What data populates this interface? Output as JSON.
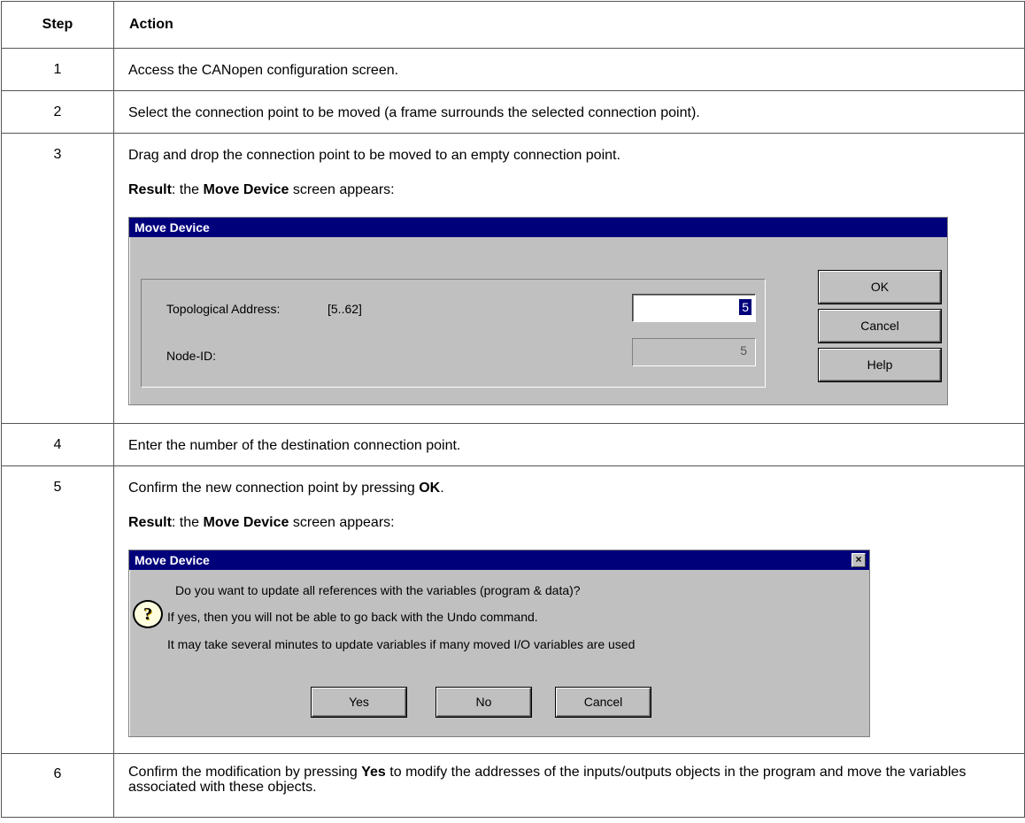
{
  "headers": {
    "step": "Step",
    "action": "Action"
  },
  "rows": [
    {
      "step": "1",
      "text": "Access the CANopen configuration screen."
    },
    {
      "step": "2",
      "text": "Select the connection point to be moved (a frame surrounds the selected connection point)."
    },
    {
      "step": "3",
      "text": "Drag and drop the connection point to be moved to an empty connection point.",
      "result_label": "Result",
      "result_pre": ": the ",
      "result_bold": "Move Device",
      "result_post": " screen appears:"
    },
    {
      "step": "4",
      "text": "Enter the number of the destination connection point."
    },
    {
      "step": "5",
      "text_pre": "Confirm the new connection point by pressing ",
      "text_bold": "OK",
      "text_post": ".",
      "result_label": "Result",
      "result_pre": ": the ",
      "result_bold": "Move Device",
      "result_post": " screen appears:"
    },
    {
      "step": "6",
      "text_pre": "Confirm the modification by pressing ",
      "text_bold": "Yes",
      "text_post": " to modify the addresses of the inputs/outputs objects in the program and move the variables associated with these objects."
    }
  ],
  "dialog1": {
    "title": "Move Device",
    "topo_label": "Topological Address:",
    "topo_range": "[5..62]",
    "topo_value": "5",
    "node_label": "Node-ID:",
    "node_value": "5",
    "ok": "OK",
    "cancel": "Cancel",
    "help": "Help"
  },
  "dialog2": {
    "title": "Move Device",
    "line1": "Do you want to update all references with the variables (program & data)?",
    "line2": "If yes, then you will not be able to go back with the Undo command.",
    "line3": "It may take several minutes to update variables if many moved I/O variables are used",
    "icon_glyph": "?",
    "close_glyph": "×",
    "yes": "Yes",
    "no": "No",
    "cancel": "Cancel"
  }
}
